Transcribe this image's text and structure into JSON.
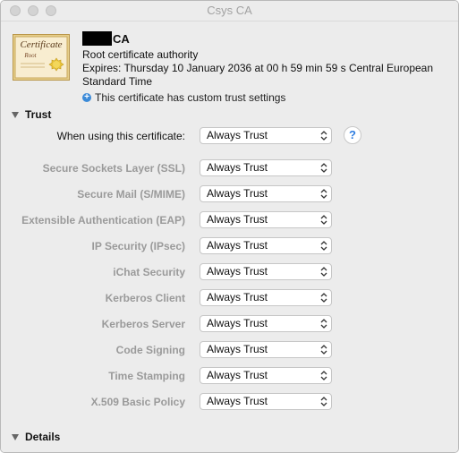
{
  "window": {
    "title": "Csys CA"
  },
  "certificate": {
    "name": "CA",
    "subtitle": "Root certificate authority",
    "expires": "Expires: Thursday 10 January 2036 at 00 h 59 min 59 s Central European Standard Time",
    "custom_trust_note": "This certificate has custom trust settings",
    "icon_text": "Certificate",
    "icon_subtext": "Root"
  },
  "trust": {
    "section_label": "Trust",
    "main_label": "When using this certificate:",
    "main_value": "Always Trust",
    "rows": [
      {
        "label": "Secure Sockets Layer (SSL)",
        "value": "Always Trust"
      },
      {
        "label": "Secure Mail (S/MIME)",
        "value": "Always Trust"
      },
      {
        "label": "Extensible Authentication (EAP)",
        "value": "Always Trust"
      },
      {
        "label": "IP Security (IPsec)",
        "value": "Always Trust"
      },
      {
        "label": "iChat Security",
        "value": "Always Trust"
      },
      {
        "label": "Kerberos Client",
        "value": "Always Trust"
      },
      {
        "label": "Kerberos Server",
        "value": "Always Trust"
      },
      {
        "label": "Code Signing",
        "value": "Always Trust"
      },
      {
        "label": "Time Stamping",
        "value": "Always Trust"
      },
      {
        "label": "X.509 Basic Policy",
        "value": "Always Trust"
      }
    ]
  },
  "details": {
    "section_label": "Details"
  },
  "help": {
    "glyph": "?"
  },
  "colors": {
    "accent": "#3b8ad8",
    "dim_text": "#9a9a9a"
  }
}
